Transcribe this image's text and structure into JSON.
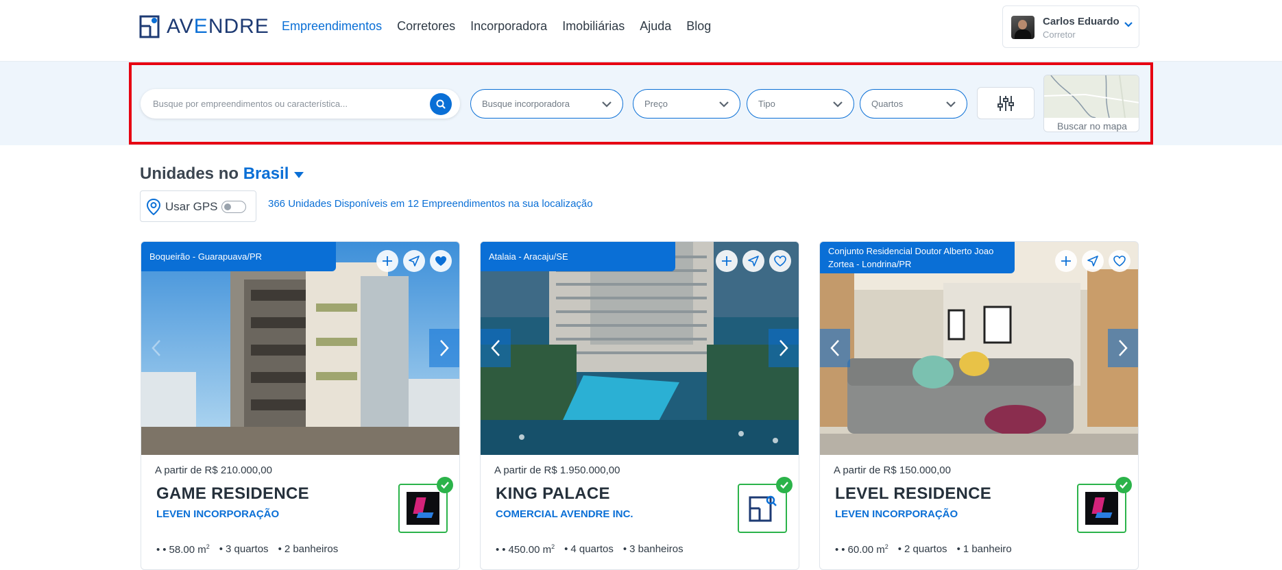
{
  "brand": {
    "logo_text_a": "AV",
    "logo_text_e": "E",
    "logo_text_b": "NDRE"
  },
  "nav": [
    "Empreendimentos",
    "Corretores",
    "Incorporadora",
    "Imobiliárias",
    "Ajuda",
    "Blog"
  ],
  "user": {
    "name": "Carlos Eduardo",
    "role": "Corretor"
  },
  "search": {
    "placeholder": "Busque por empreendimentos ou característica...",
    "incorporadora": "Busque incorporadora",
    "preco": "Preço",
    "tipo": "Tipo",
    "quartos": "Quartos",
    "map_label": "Buscar no mapa"
  },
  "section": {
    "title_prefix": "Unidades no",
    "location": "Brasil",
    "gps_label": "Usar GPS",
    "count_text": "366 Unidades Disponíveis em 12 Empreendimentos na sua localização"
  },
  "colors": {
    "accent": "#0a6fd6",
    "verified": "#2bb34a",
    "highlight_frame": "#e60012"
  },
  "cards": [
    {
      "location": "Boqueirão - Guarapuava/PR",
      "price": "A partir de R$ 210.000,00",
      "name": "GAME RESIDENCE",
      "company": "LEVEN INCORPORAÇÃO",
      "area": "58.00 m",
      "area_unit_sup": "2",
      "rooms": "3 quartos",
      "baths": "2 banheiros",
      "favorited": true
    },
    {
      "location": "Atalaia - Aracaju/SE",
      "price": "A partir de R$ 1.950.000,00",
      "name": "KING PALACE",
      "company": "COMERCIAL AVENDRE INC.",
      "area": "450.00 m",
      "area_unit_sup": "2",
      "rooms": "4 quartos",
      "baths": "3 banheiros",
      "favorited": false
    },
    {
      "location": "Conjunto Residencial Doutor Alberto Joao Zortea - Londrina/PR",
      "price": "A partir de R$ 150.000,00",
      "name": "LEVEL RESIDENCE",
      "company": "LEVEN INCORPORAÇÃO",
      "area": "60.00 m",
      "area_unit_sup": "2",
      "rooms": "2 quartos",
      "baths": "1 banheiro",
      "favorited": false
    }
  ]
}
